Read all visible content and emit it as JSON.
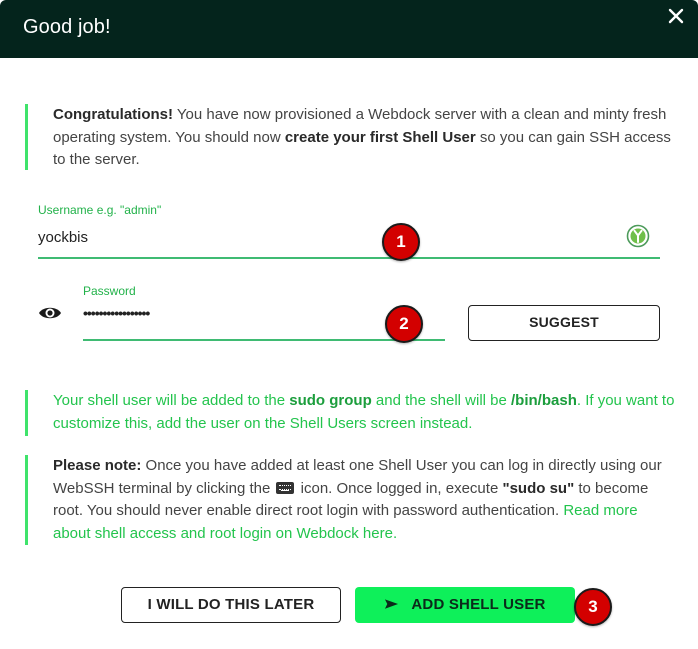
{
  "dialog": {
    "title": "Good job!"
  },
  "intro": {
    "bold_start": "Congratulations!",
    "text1": " You have now provisioned a Webdock server with a clean and minty fresh operating system. You should now ",
    "bold_mid": "create your first Shell User",
    "text2": " so you can gain SSH access to the server."
  },
  "username": {
    "label": "Username e.g. \"admin\"",
    "value": "yockbis"
  },
  "password": {
    "label": "Password",
    "value": "•••••••••••••••••"
  },
  "suggest_button": "SUGGEST",
  "sudo_note": {
    "text1": "Your shell user will be added to the ",
    "bold1": "sudo group",
    "text2": " and the shell will be ",
    "bold2": "/bin/bash",
    "text3": ". If you want to customize this, add the user on the Shell Users screen instead."
  },
  "please_note": {
    "bold1": "Please note:",
    "text1": " Once you have added at least one Shell User you can log in directly using our WebSSH terminal by clicking the ",
    "text2": " icon. Once logged in, execute ",
    "bold2": "\"sudo su\"",
    "text3": " to become root. You should never enable direct root login with password authentication.",
    "link": "Read more about shell access and root login on Webdock here."
  },
  "buttons": {
    "later": "I WILL DO THIS LATER",
    "add": "ADD SHELL USER"
  },
  "badges": {
    "one": "1",
    "two": "2",
    "three": "3"
  },
  "colors": {
    "header_bg": "#04241c",
    "accent_green": "#0ef05a",
    "text_green": "#23c44d",
    "badge_red": "#d30000"
  },
  "icons": [
    "close-icon",
    "eye-icon",
    "user-avatar-icon",
    "keyboard-icon",
    "send-icon"
  ]
}
